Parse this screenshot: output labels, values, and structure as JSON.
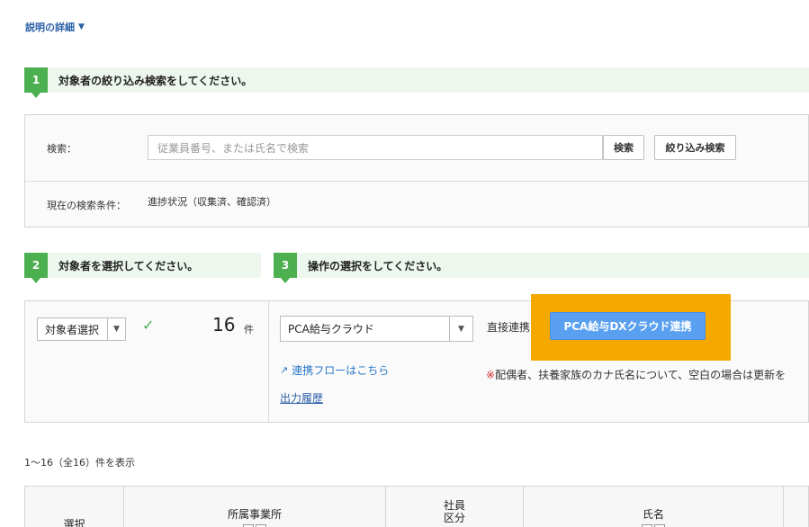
{
  "description_toggle": {
    "label": "説明の詳細",
    "chevron": "chevron-down-icon"
  },
  "step1": {
    "number": "1",
    "title": "対象者の絞り込み検索をしてください。"
  },
  "search": {
    "label": "検索：",
    "placeholder": "従業員番号、または氏名で検索",
    "search_button": "検索",
    "filter_button": "絞り込み検索",
    "condition_label": "現在の検索条件：",
    "condition_value": "進捗状況（収集済、確認済）"
  },
  "step2": {
    "number": "2",
    "title": "対象者を選択してください。"
  },
  "step3": {
    "number": "3",
    "title": "操作の選択をしてください。"
  },
  "selection": {
    "select_label": "対象者選択",
    "count": "16",
    "count_unit": "件"
  },
  "operation": {
    "target_select": "PCA給与クラウド",
    "direct_label": "直接連携",
    "pca_button": "PCA給与DXクラウド連携",
    "flow_link": "連携フローはこちら",
    "history_link": "出力履歴",
    "note_mark": "※",
    "note_text": "配偶者、扶養家族のカナ氏名について、空白の場合は更新を"
  },
  "results": {
    "summary": "1～16（全16）件を表示"
  },
  "table": {
    "headers": {
      "select": "選択",
      "office": "所属事業所",
      "employee_type_line1": "社員",
      "employee_type_line2": "区分",
      "name": "氏名"
    }
  },
  "colors": {
    "step_green": "#4caf50",
    "highlight": "#f5a800",
    "primary_button": "#5aa0f0",
    "link": "#2a78c8",
    "warning": "#d32f2f"
  }
}
